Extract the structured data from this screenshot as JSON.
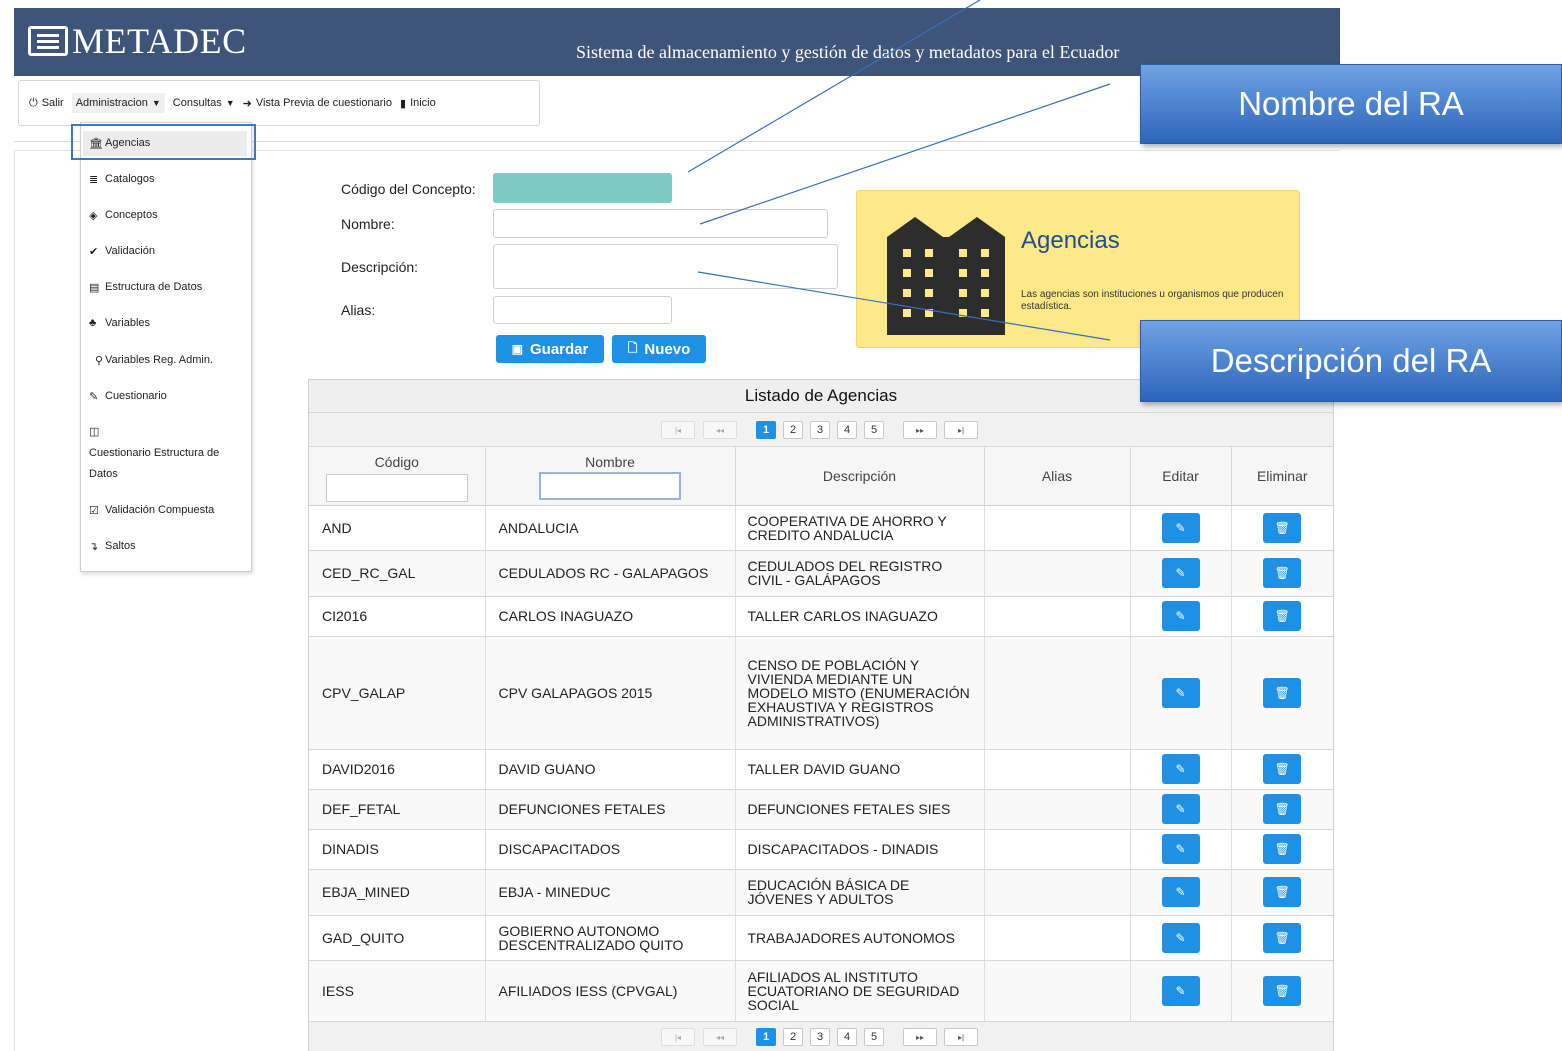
{
  "header": {
    "logo_text": "METADEC",
    "subtitle": "Sistema de almacenamiento y gestión de datos y metadatos para el Ecuador"
  },
  "menubar": {
    "items": [
      {
        "label": "Salir",
        "icon": "power-icon"
      },
      {
        "label": "Administracion",
        "icon": "",
        "dropdown": true
      },
      {
        "label": "Consultas",
        "icon": "",
        "dropdown": true
      },
      {
        "label": "Vista Previa de cuestionario",
        "icon": "sign-in-icon"
      },
      {
        "label": "Inicio",
        "icon": "book-icon"
      }
    ]
  },
  "admin_menu": {
    "items": [
      {
        "label": "Agencias",
        "icon": "institution-icon"
      },
      {
        "label": "Catalogos",
        "icon": "list-icon"
      },
      {
        "label": "Conceptos",
        "icon": "cube-icon"
      },
      {
        "label": "Validación",
        "icon": "check-circle-icon"
      },
      {
        "label": "Estructura de Datos",
        "icon": "table-icon"
      },
      {
        "label": "Variables",
        "icon": "cubes-icon"
      },
      {
        "label": "Variables Reg. Admin.",
        "icon": "user-icon"
      },
      {
        "label": "Cuestionario",
        "icon": "edit-icon"
      },
      {
        "label": "Cuestionario Estructura de Datos",
        "icon": "columns-icon"
      },
      {
        "label": "Validación Compuesta",
        "icon": "check-square-icon"
      },
      {
        "label": "Saltos",
        "icon": "level-down-icon"
      }
    ]
  },
  "form": {
    "codigo_label": "Código del Concepto:",
    "nombre_label": "Nombre:",
    "descripcion_label": "Descripción:",
    "alias_label": "Alias:",
    "codigo_value": "",
    "nombre_value": "",
    "descripcion_value": "",
    "alias_value": "",
    "save_label": "Guardar",
    "new_label": "Nuevo"
  },
  "info_card": {
    "title": "Agencias",
    "text": "Las agencias son instituciones u organismos que producen estadística."
  },
  "callouts": {
    "nombre": "Nombre del RA",
    "descripcion": "Descripción del RA"
  },
  "table": {
    "title": "Listado de Agencias",
    "pages": [
      "1",
      "2",
      "3",
      "4",
      "5"
    ],
    "current_page": 1,
    "pager_glyphs": {
      "first": "|◂",
      "prev": "◂◂",
      "next": "▸▸",
      "last": "▸|"
    },
    "columns": [
      "Código",
      "Nombre",
      "Descripción",
      "Alias",
      "Editar",
      "Eliminar"
    ],
    "rows": [
      {
        "codigo": "AND",
        "nombre": "ANDALUCIA",
        "descripcion": "COOPERATIVA DE AHORRO Y CREDITO ANDALUCIA",
        "alias": ""
      },
      {
        "codigo": "CED_RC_GAL",
        "nombre": "CEDULADOS RC - GALAPAGOS",
        "descripcion": "CEDULADOS DEL REGISTRO CIVIL - GALÁPAGOS",
        "alias": ""
      },
      {
        "codigo": "CI2016",
        "nombre": "CARLOS INAGUAZO",
        "descripcion": "TALLER CARLOS INAGUAZO",
        "alias": ""
      },
      {
        "codigo": "CPV_GALAP",
        "nombre": "CPV GALAPAGOS 2015",
        "descripcion": "CENSO DE POBLACIÓN Y VIVIENDA MEDIANTE UN MODELO MISTO (ENUMERACIÓN EXHAUSTIVA Y REGISTROS ADMINISTRATIVOS)",
        "alias": ""
      },
      {
        "codigo": "DAVID2016",
        "nombre": "DAVID GUANO",
        "descripcion": "TALLER DAVID GUANO",
        "alias": ""
      },
      {
        "codigo": "DEF_FETAL",
        "nombre": "DEFUNCIONES FETALES",
        "descripcion": "DEFUNCIONES FETALES SIES",
        "alias": ""
      },
      {
        "codigo": "DINADIS",
        "nombre": "DISCAPACITADOS",
        "descripcion": "DISCAPACITADOS - DINADIS",
        "alias": ""
      },
      {
        "codigo": "EBJA_MINED",
        "nombre": "EBJA - MINEDUC",
        "descripcion": "EDUCACIÓN BÁSICA DE JÓVENES Y ADULTOS",
        "alias": ""
      },
      {
        "codigo": "GAD_QUITO",
        "nombre": "GOBIERNO AUTONOMO DESCENTRALIZADO QUITO",
        "descripcion": "TRABAJADORES AUTONOMOS",
        "alias": ""
      },
      {
        "codigo": "IESS",
        "nombre": "AFILIADOS IESS (CPVGAL)",
        "descripcion": "AFILIADOS AL INSTITUTO ECUATORIANO DE SEGURIDAD SOCIAL",
        "alias": ""
      }
    ]
  },
  "colors": {
    "header_bg": "#3e5478",
    "accent_blue": "#1e90e6",
    "teal_input": "#7fcac3",
    "info_card_bg": "#fde98a",
    "callout_blue": "#2d65bb"
  }
}
